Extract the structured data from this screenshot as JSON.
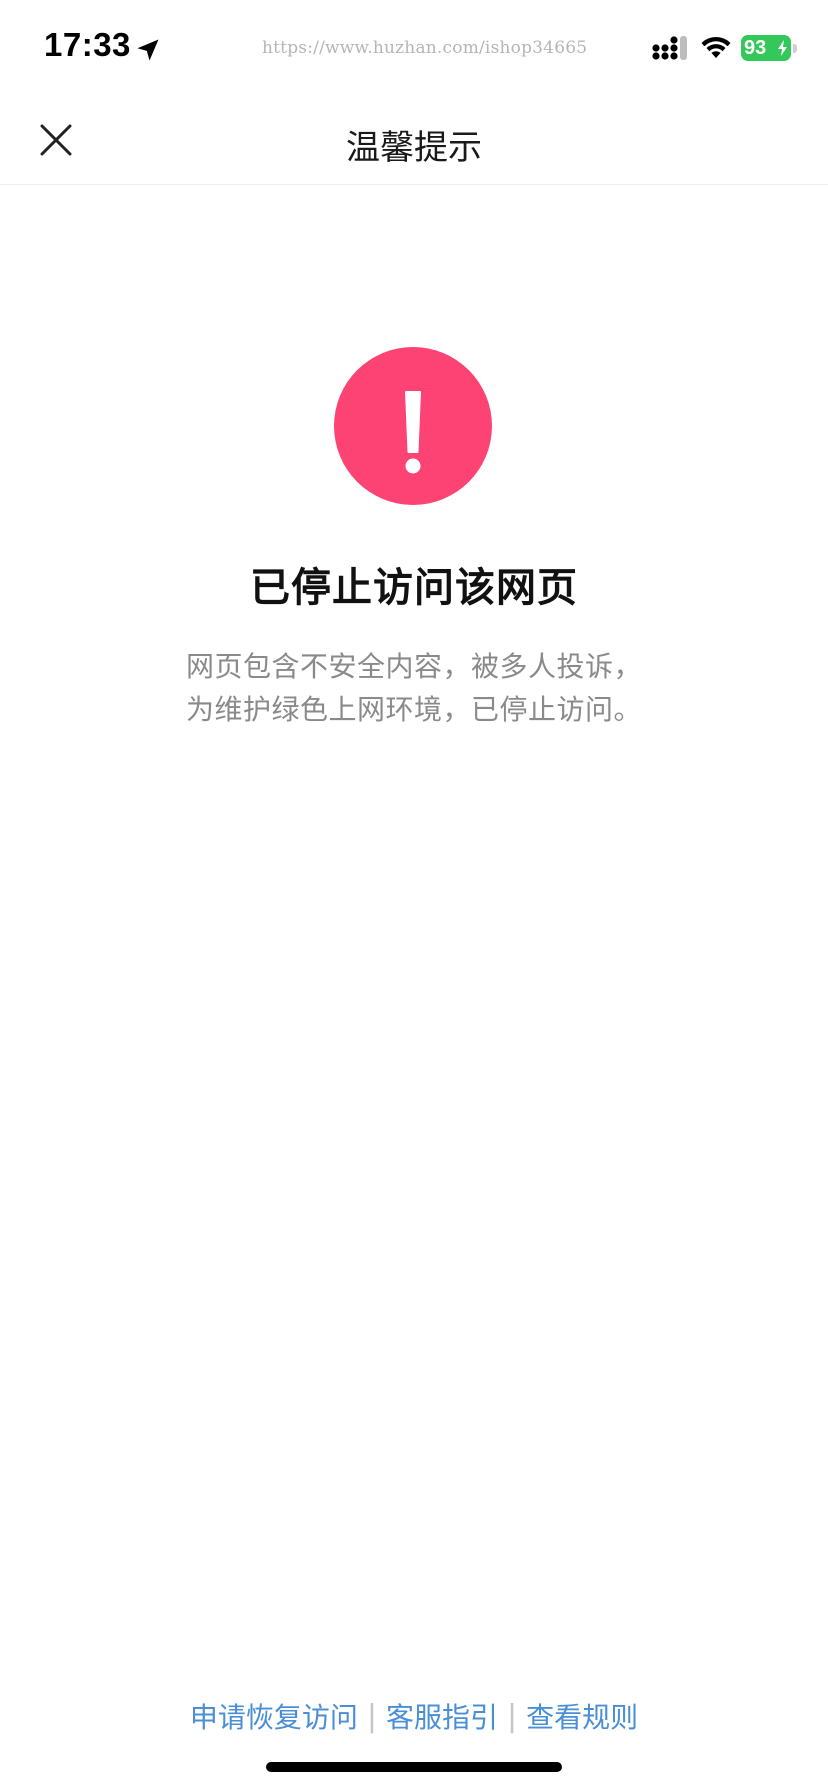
{
  "status_bar": {
    "time": "17:33",
    "url_watermark": "https://www.huzhan.com/ishop34665",
    "battery_level": "93",
    "icons": [
      "location-arrow-icon",
      "signal-icon",
      "wifi-icon",
      "battery-charging-icon"
    ],
    "battery_color": "#34c759"
  },
  "nav": {
    "title": "温馨提示",
    "close_icon": "close-icon"
  },
  "main": {
    "alert_icon": "exclamation-circle-icon",
    "alert_color": "#fd4373",
    "heading": "已停止访问该网页",
    "description_lines": [
      "网页包含不安全内容，被多人投诉，",
      "为维护绿色上网环境，已停止访问。"
    ]
  },
  "footer": {
    "links": [
      "申请恢复访问",
      "客服指引",
      "查看规则"
    ],
    "separator": "|",
    "link_color": "#4a8fd6"
  }
}
